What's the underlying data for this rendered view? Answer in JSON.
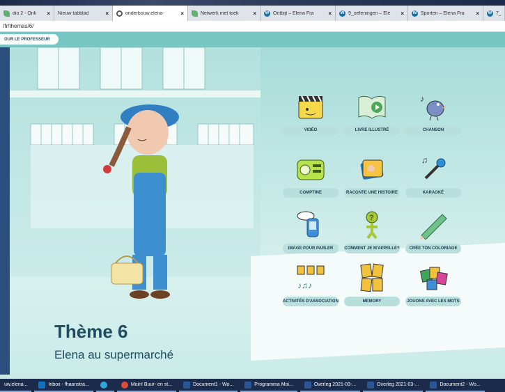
{
  "browser": {
    "tabs": [
      {
        "label": "dio 2 - Onli",
        "icon": "leaf-icon",
        "active": false
      },
      {
        "label": "Nieuw tabblad",
        "icon": "",
        "active": false
      },
      {
        "label": "onderbouw.elena-",
        "icon": "chrome-icon",
        "active": true
      },
      {
        "label": "Netwerk met toek",
        "icon": "leaf-icon",
        "active": false
      },
      {
        "label": "Ontbijt – Elena Fra",
        "icon": "wordpress-icon",
        "active": false
      },
      {
        "label": "9_oefeningen – Ele",
        "icon": "wordpress-icon",
        "active": false
      },
      {
        "label": "Sporten – Elena Fra",
        "icon": "wordpress-icon",
        "active": false
      },
      {
        "label": "7_",
        "icon": "wordpress-icon",
        "active": false
      }
    ],
    "close_glyph": "×",
    "address": "/fr/themas/6/"
  },
  "page": {
    "professor_button": "OUR LE PROFESSEUR",
    "theme_title": "Thème 6",
    "theme_subtitle": "Elena au supermarché",
    "activities": [
      {
        "label": "VIDÉO",
        "icon": "video-clapper-icon"
      },
      {
        "label": "LIVRE ILLUSTRÉ",
        "icon": "book-play-icon"
      },
      {
        "label": "CHANSON",
        "icon": "singing-bird-icon"
      },
      {
        "label": "COMPTINE",
        "icon": "radio-icon"
      },
      {
        "label": "RACONTE UNE HISTOIRE",
        "icon": "story-cards-icon"
      },
      {
        "label": "KARAOKÉ",
        "icon": "microphone-icon"
      },
      {
        "label": "IMAGE POUR PARLER",
        "icon": "speech-phone-icon"
      },
      {
        "label": "COMMENT JE M'APPELLE?",
        "icon": "question-figure-icon"
      },
      {
        "label": "CRÉE TON COLORIAGE",
        "icon": "pencil-icon"
      },
      {
        "label": "ACTIVITÉS D'ASSOCIATION",
        "icon": "matching-notes-icon"
      },
      {
        "label": "MEMORY",
        "icon": "memory-cards-icon"
      },
      {
        "label": "JOUONS AVEC LES MOTS",
        "icon": "word-cards-icon"
      }
    ]
  },
  "taskbar": {
    "items": [
      {
        "label": "uw.elena...",
        "icon": ""
      },
      {
        "label": "Inbox - fhaanstra...",
        "icon": "outlook-icon"
      },
      {
        "label": "",
        "icon": "edge-icon"
      },
      {
        "label": "Moin! Buur- en st...",
        "icon": "chrome-icon"
      },
      {
        "label": "Document1 - Wo...",
        "icon": "word-icon"
      },
      {
        "label": "Programma Moi...",
        "icon": "word-icon"
      },
      {
        "label": "Overleg 2021-03-...",
        "icon": "word-icon"
      },
      {
        "label": "Overleg 2021-03-...",
        "icon": "word-icon"
      },
      {
        "label": "Document2 - Wo...",
        "icon": "word-icon"
      }
    ]
  },
  "colors": {
    "page_bg": "#7ecdc9",
    "title": "#1f4c60",
    "label_pill": "#b9dfdc",
    "taskbar": "#1a2b4c"
  }
}
